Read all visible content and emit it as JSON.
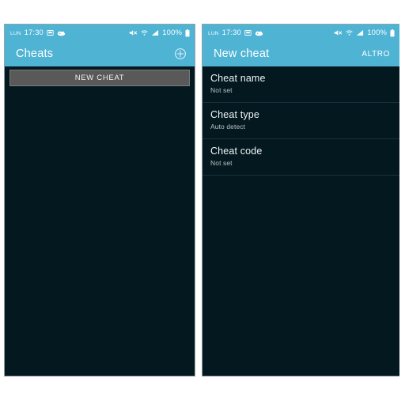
{
  "left_panel": {
    "statusbar": {
      "day": "LUN",
      "time": "17:30",
      "icons": [
        "sd-card-icon",
        "cloud-sync-icon"
      ],
      "right_icons": [
        "mute-icon",
        "wifi-icon",
        "signal-icon"
      ],
      "battery_text": "100%",
      "battery_icon": "battery-full-icon"
    },
    "appbar": {
      "title": "Cheats",
      "action_icon": "add-circle-icon"
    },
    "new_cheat_button": "NEW CHEAT"
  },
  "right_panel": {
    "statusbar": {
      "day": "LUN",
      "time": "17:30",
      "icons": [
        "sd-card-icon",
        "cloud-sync-icon"
      ],
      "right_icons": [
        "mute-icon",
        "wifi-icon",
        "signal-icon"
      ],
      "battery_text": "100%",
      "battery_icon": "battery-full-icon"
    },
    "appbar": {
      "title": "New cheat",
      "action_label": "ALTRO"
    },
    "rows": [
      {
        "title": "Cheat name",
        "value": "Not set"
      },
      {
        "title": "Cheat type",
        "value": "Auto detect"
      },
      {
        "title": "Cheat code",
        "value": "Not set"
      }
    ]
  },
  "colors": {
    "accent": "#4fb3d4",
    "background": "#04181f",
    "button": "#595959",
    "divider": "#16323c",
    "text_primary": "#eef4f6",
    "text_secondary": "#b7c4c8"
  }
}
